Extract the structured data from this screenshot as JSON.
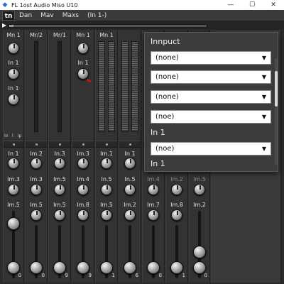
{
  "window": {
    "title": "FL 1ost Audio Miso U10",
    "app_icon": "fl-logo-icon",
    "controls": [
      "—",
      "☐",
      "✕"
    ]
  },
  "menubar": {
    "logo": "tn",
    "items": [
      "Dan",
      "Mav",
      "Maxs",
      "(In 1-)"
    ]
  },
  "transport": {
    "play_glyph": "▶",
    "progress": 0.02
  },
  "mixer": {
    "strips": [
      {
        "top": "Mn 1",
        "a": "In 1",
        "b": "In 1",
        "mid": "In 1",
        "mid2": "Im.3",
        "mid3": "Im.5",
        "val": "0"
      },
      {
        "top": "Mr/2",
        "mid": "Im.2",
        "mid2": "Im.3",
        "mid3": "Im.5",
        "val": "0"
      },
      {
        "top": "Mr/1",
        "mid": "In.3",
        "mid2": "Im.5",
        "mid3": "Im.5",
        "val": "9"
      },
      {
        "top": "Mn 1",
        "a": "In 1",
        "mid": "Im.3",
        "mid2": "Im.4",
        "mid3": "Im.8",
        "val": "9"
      },
      {
        "top": "Mn 1",
        "mid": "Im.1",
        "mid2": "In.5",
        "mid3": "Im.5",
        "val": "1"
      },
      {
        "top": "",
        "mid": "In 1",
        "mid2": "In.5",
        "mid3": "Im.2",
        "val": "6"
      },
      {
        "top": "",
        "mid": "",
        "mid2": "Im.4",
        "mid3": "Im.7",
        "val": "0"
      },
      {
        "top": "",
        "mid": "",
        "mid2": "Im.2",
        "mid3": "Im.8",
        "val": "1"
      },
      {
        "top": "",
        "mid": "",
        "mid2": "Im.5",
        "mid3": "Im.2",
        "val": "0"
      }
    ],
    "io_label_left": "In",
    "io_label_mid": "l",
    "io_label_right": "ip"
  },
  "input_panel": {
    "title": "Innpuct",
    "dropdowns": [
      "(none)",
      "(none)",
      "(none)",
      "(noe)"
    ],
    "section1": "In 1",
    "section1_dropdown": "(noe)",
    "section2": "In 1",
    "arrow_glyph": "▼"
  }
}
